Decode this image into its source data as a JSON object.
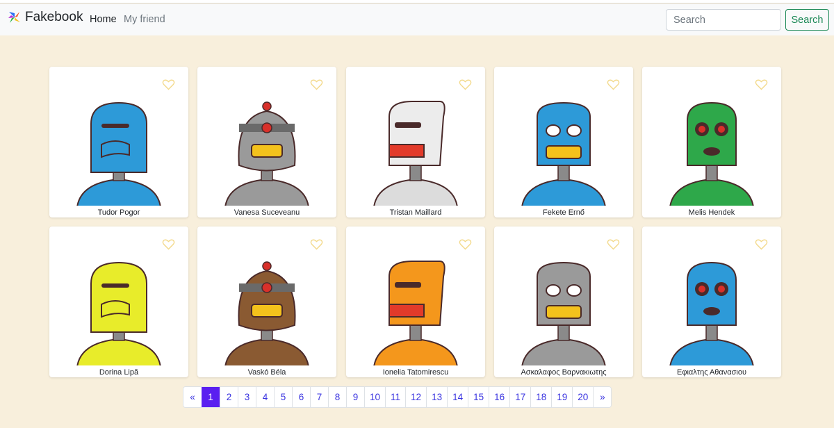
{
  "nav": {
    "brand": "Fakebook",
    "home": "Home",
    "friend": "My friend",
    "search_placeholder": "Search",
    "search_button": "Search"
  },
  "cards": [
    {
      "name": "Tudor Pogor",
      "color": "#2d9ad8",
      "body": "#2d9ad8"
    },
    {
      "name": "Vanesa Suceveanu",
      "color": "#9a9a9a",
      "body": "#9a9a9a"
    },
    {
      "name": "Tristan Maillard",
      "color": "#ececec",
      "body": "#dcdcdc"
    },
    {
      "name": "Fekete Ernő",
      "color": "#2d9ad8",
      "body": "#2d9ad8"
    },
    {
      "name": "Melis Hendek",
      "color": "#2ea84a",
      "body": "#2ea84a"
    },
    {
      "name": "Dorina Lipă",
      "color": "#e8ec2a",
      "body": "#e8ec2a"
    },
    {
      "name": "Vaskó Béla",
      "color": "#8a5a32",
      "body": "#8a5a32"
    },
    {
      "name": "Ionelia Tatomirescu",
      "color": "#f4971c",
      "body": "#f4971c"
    },
    {
      "name": "Ασκαλαφος Βαρνακιωτης",
      "color": "#9a9a9a",
      "body": "#9a9a9a"
    },
    {
      "name": "Εφιαλτης Αθανασιου",
      "color": "#2d9ad8",
      "body": "#2d9ad8"
    }
  ],
  "pagination": {
    "prev": "«",
    "next": "»",
    "pages": [
      "1",
      "2",
      "3",
      "4",
      "5",
      "6",
      "7",
      "8",
      "9",
      "10",
      "11",
      "12",
      "13",
      "14",
      "15",
      "16",
      "17",
      "18",
      "19",
      "20"
    ],
    "active": "1"
  },
  "colors": {
    "accent": "#5a1ff0",
    "success": "#198754",
    "background": "#f8efdc",
    "heart": "#f3d98a"
  }
}
